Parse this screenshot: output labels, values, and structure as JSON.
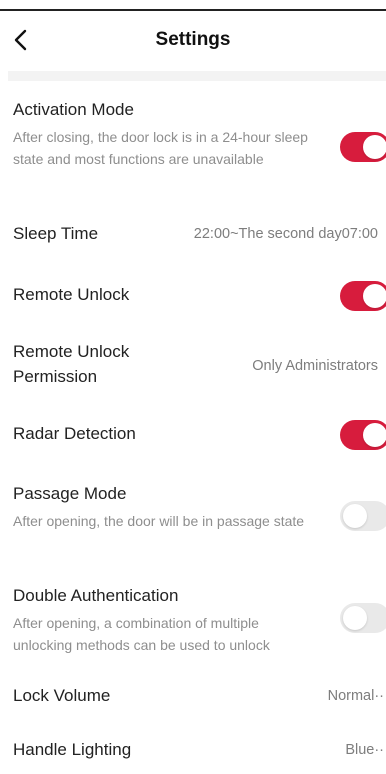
{
  "header": {
    "title": "Settings",
    "back_icon": "chevron-left-icon"
  },
  "settings": {
    "activation_mode": {
      "label": "Activation Mode",
      "description": "After closing, the door lock is in a 24-hour sleep state and most functions are unavailable",
      "enabled": true
    },
    "sleep_time": {
      "label": "Sleep Time",
      "value": "22:00~The second day07:00"
    },
    "remote_unlock": {
      "label": "Remote Unlock",
      "enabled": true
    },
    "remote_unlock_permission": {
      "label_line1": "Remote Unlock",
      "label_line2": "Permission",
      "value": "Only Administrators"
    },
    "radar_detection": {
      "label": "Radar Detection",
      "enabled": true
    },
    "passage_mode": {
      "label": "Passage Mode",
      "description": "After opening, the door will be in passage state",
      "enabled": false
    },
    "double_authentication": {
      "label": "Double Authentication",
      "description": "After opening, a combination of multiple unlocking methods can be used to unlock",
      "enabled": false
    },
    "lock_volume": {
      "label": "Lock Volume",
      "value": "Normal··"
    },
    "handle_lighting": {
      "label": "Handle Lighting",
      "value": "Blue··"
    }
  },
  "colors": {
    "accent": "#d71c3d",
    "toggle_off": "#e9e9e9",
    "secondary_text": "#8e8e8e"
  }
}
